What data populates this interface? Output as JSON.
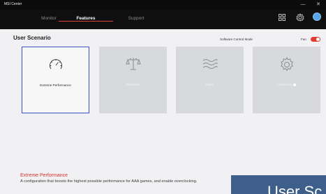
{
  "window": {
    "title": "MSI Center",
    "minimize_glyph": "—",
    "close_glyph": "✕"
  },
  "header": {
    "tabs": [
      {
        "label": "Monitor",
        "active": false
      },
      {
        "label": "Features",
        "active": true
      },
      {
        "label": "Support",
        "active": false
      }
    ],
    "icons": [
      "grid-icon",
      "settings-icon",
      "user-avatar"
    ],
    "accent_color": "#e1443c"
  },
  "section": {
    "title": "User Scenario",
    "software_control_label": "Software Control Mode",
    "fan_label": "Fan",
    "fan_enabled": true
  },
  "scenarios": [
    {
      "label": "Extreme Performance",
      "icon": "speedometer-icon",
      "selected": true
    },
    {
      "label": "Balanced",
      "icon": "scale-icon",
      "selected": false
    },
    {
      "label": "Silent",
      "icon": "wind-icon",
      "selected": false
    },
    {
      "label": "Customize",
      "icon": "gear-icon",
      "selected": false
    }
  ],
  "description": {
    "title": "Extreme Performance",
    "text": "A configuration that boosts the highest possible performance for AAA games, and enable overclocking."
  },
  "overlay": {
    "text": "User Sc"
  }
}
